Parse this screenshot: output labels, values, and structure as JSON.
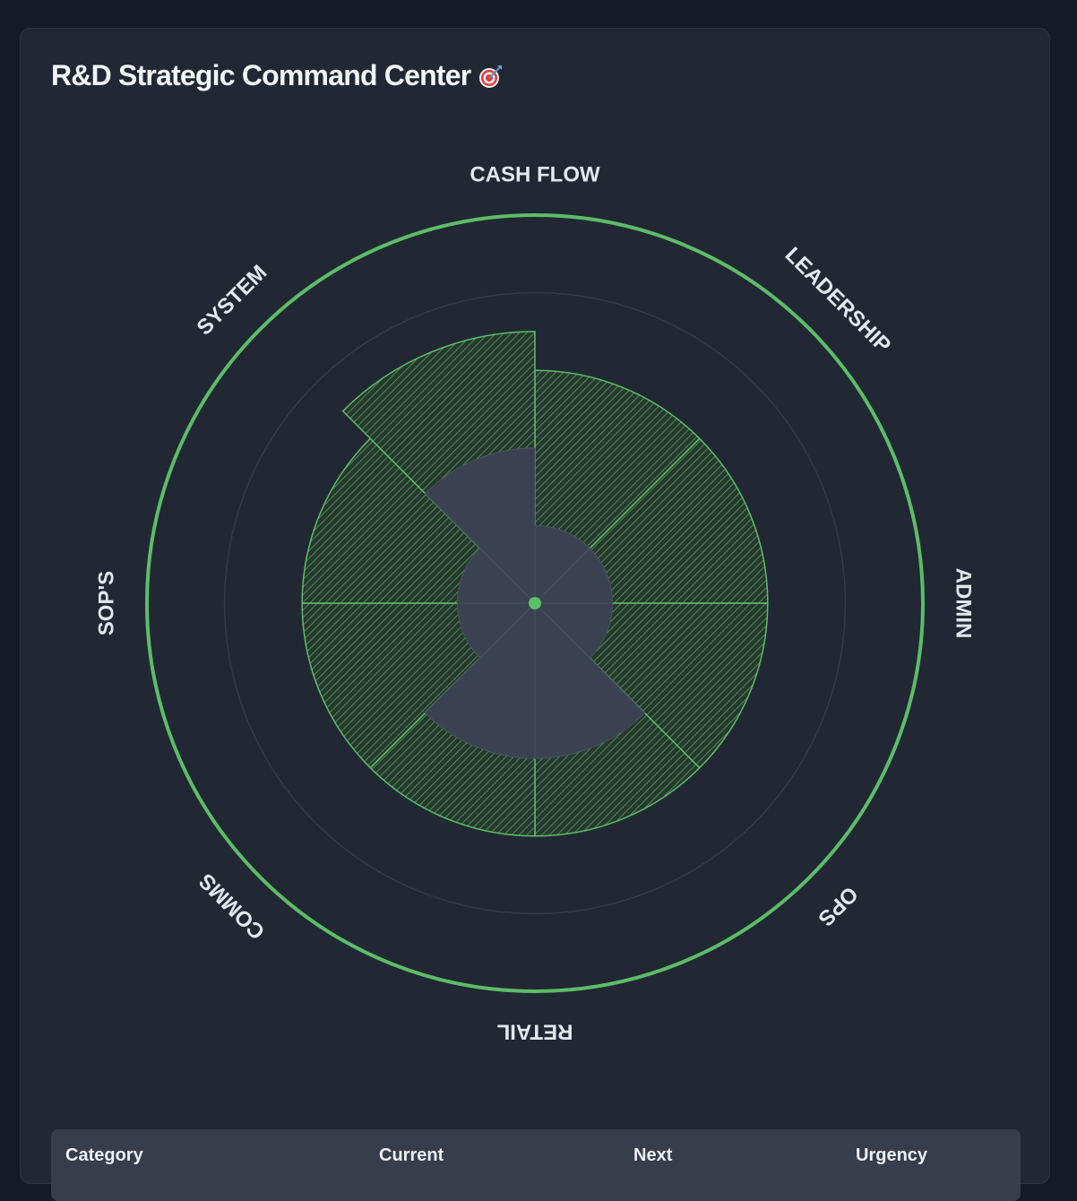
{
  "header": {
    "title": "R&D Strategic Command Center"
  },
  "chart_data": {
    "type": "polar-area",
    "title": "",
    "categories": [
      "CASH FLOW",
      "LEADERSHIP",
      "ADMIN",
      "OPS",
      "RETAIL",
      "COMMS",
      "SOP'S",
      "SYSTEM"
    ],
    "series": [
      {
        "values": [
          3,
          3,
          3,
          3,
          3,
          3,
          3,
          3.5
        ]
      },
      {
        "values": [
          1,
          1,
          1,
          2,
          2,
          1,
          1,
          2
        ]
      }
    ],
    "rlim": [
      0,
      5
    ],
    "grid_rings": [
      4
    ],
    "colors": {
      "next": "#5cbd68",
      "current": "#3a4150",
      "outer_ring": "#5cbd68",
      "grid": "#343b46",
      "label": "#e4e7ec"
    }
  },
  "table": {
    "headers": [
      "Category",
      "Current",
      "Next",
      "Urgency"
    ]
  }
}
